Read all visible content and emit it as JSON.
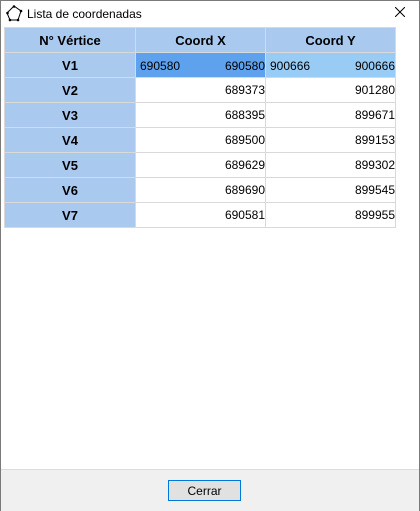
{
  "window": {
    "title": "Lista de coordenadas"
  },
  "icons": {
    "app": "polygon-icon",
    "close": "close-icon"
  },
  "colors": {
    "header_bg": "#a9c9ef",
    "selected_x": "#5ea2ee",
    "selected_y": "#98ccf5",
    "button_focus": "#0078d7"
  },
  "table": {
    "headers": [
      "N° Vértice",
      "Coord X",
      "Coord Y"
    ],
    "rows": [
      {
        "vertex": "V1",
        "x": "690580",
        "y": "900666",
        "x_edit": "690580",
        "y_edit": "900666"
      },
      {
        "vertex": "V2",
        "x": "689373",
        "y": "901280"
      },
      {
        "vertex": "V3",
        "x": "688395",
        "y": "899671"
      },
      {
        "vertex": "V4",
        "x": "689500",
        "y": "899153"
      },
      {
        "vertex": "V5",
        "x": "689629",
        "y": "899302"
      },
      {
        "vertex": "V6",
        "x": "689690",
        "y": "899545"
      },
      {
        "vertex": "V7",
        "x": "690581",
        "y": "899955"
      }
    ]
  },
  "footer": {
    "close_label": "Cerrar"
  }
}
